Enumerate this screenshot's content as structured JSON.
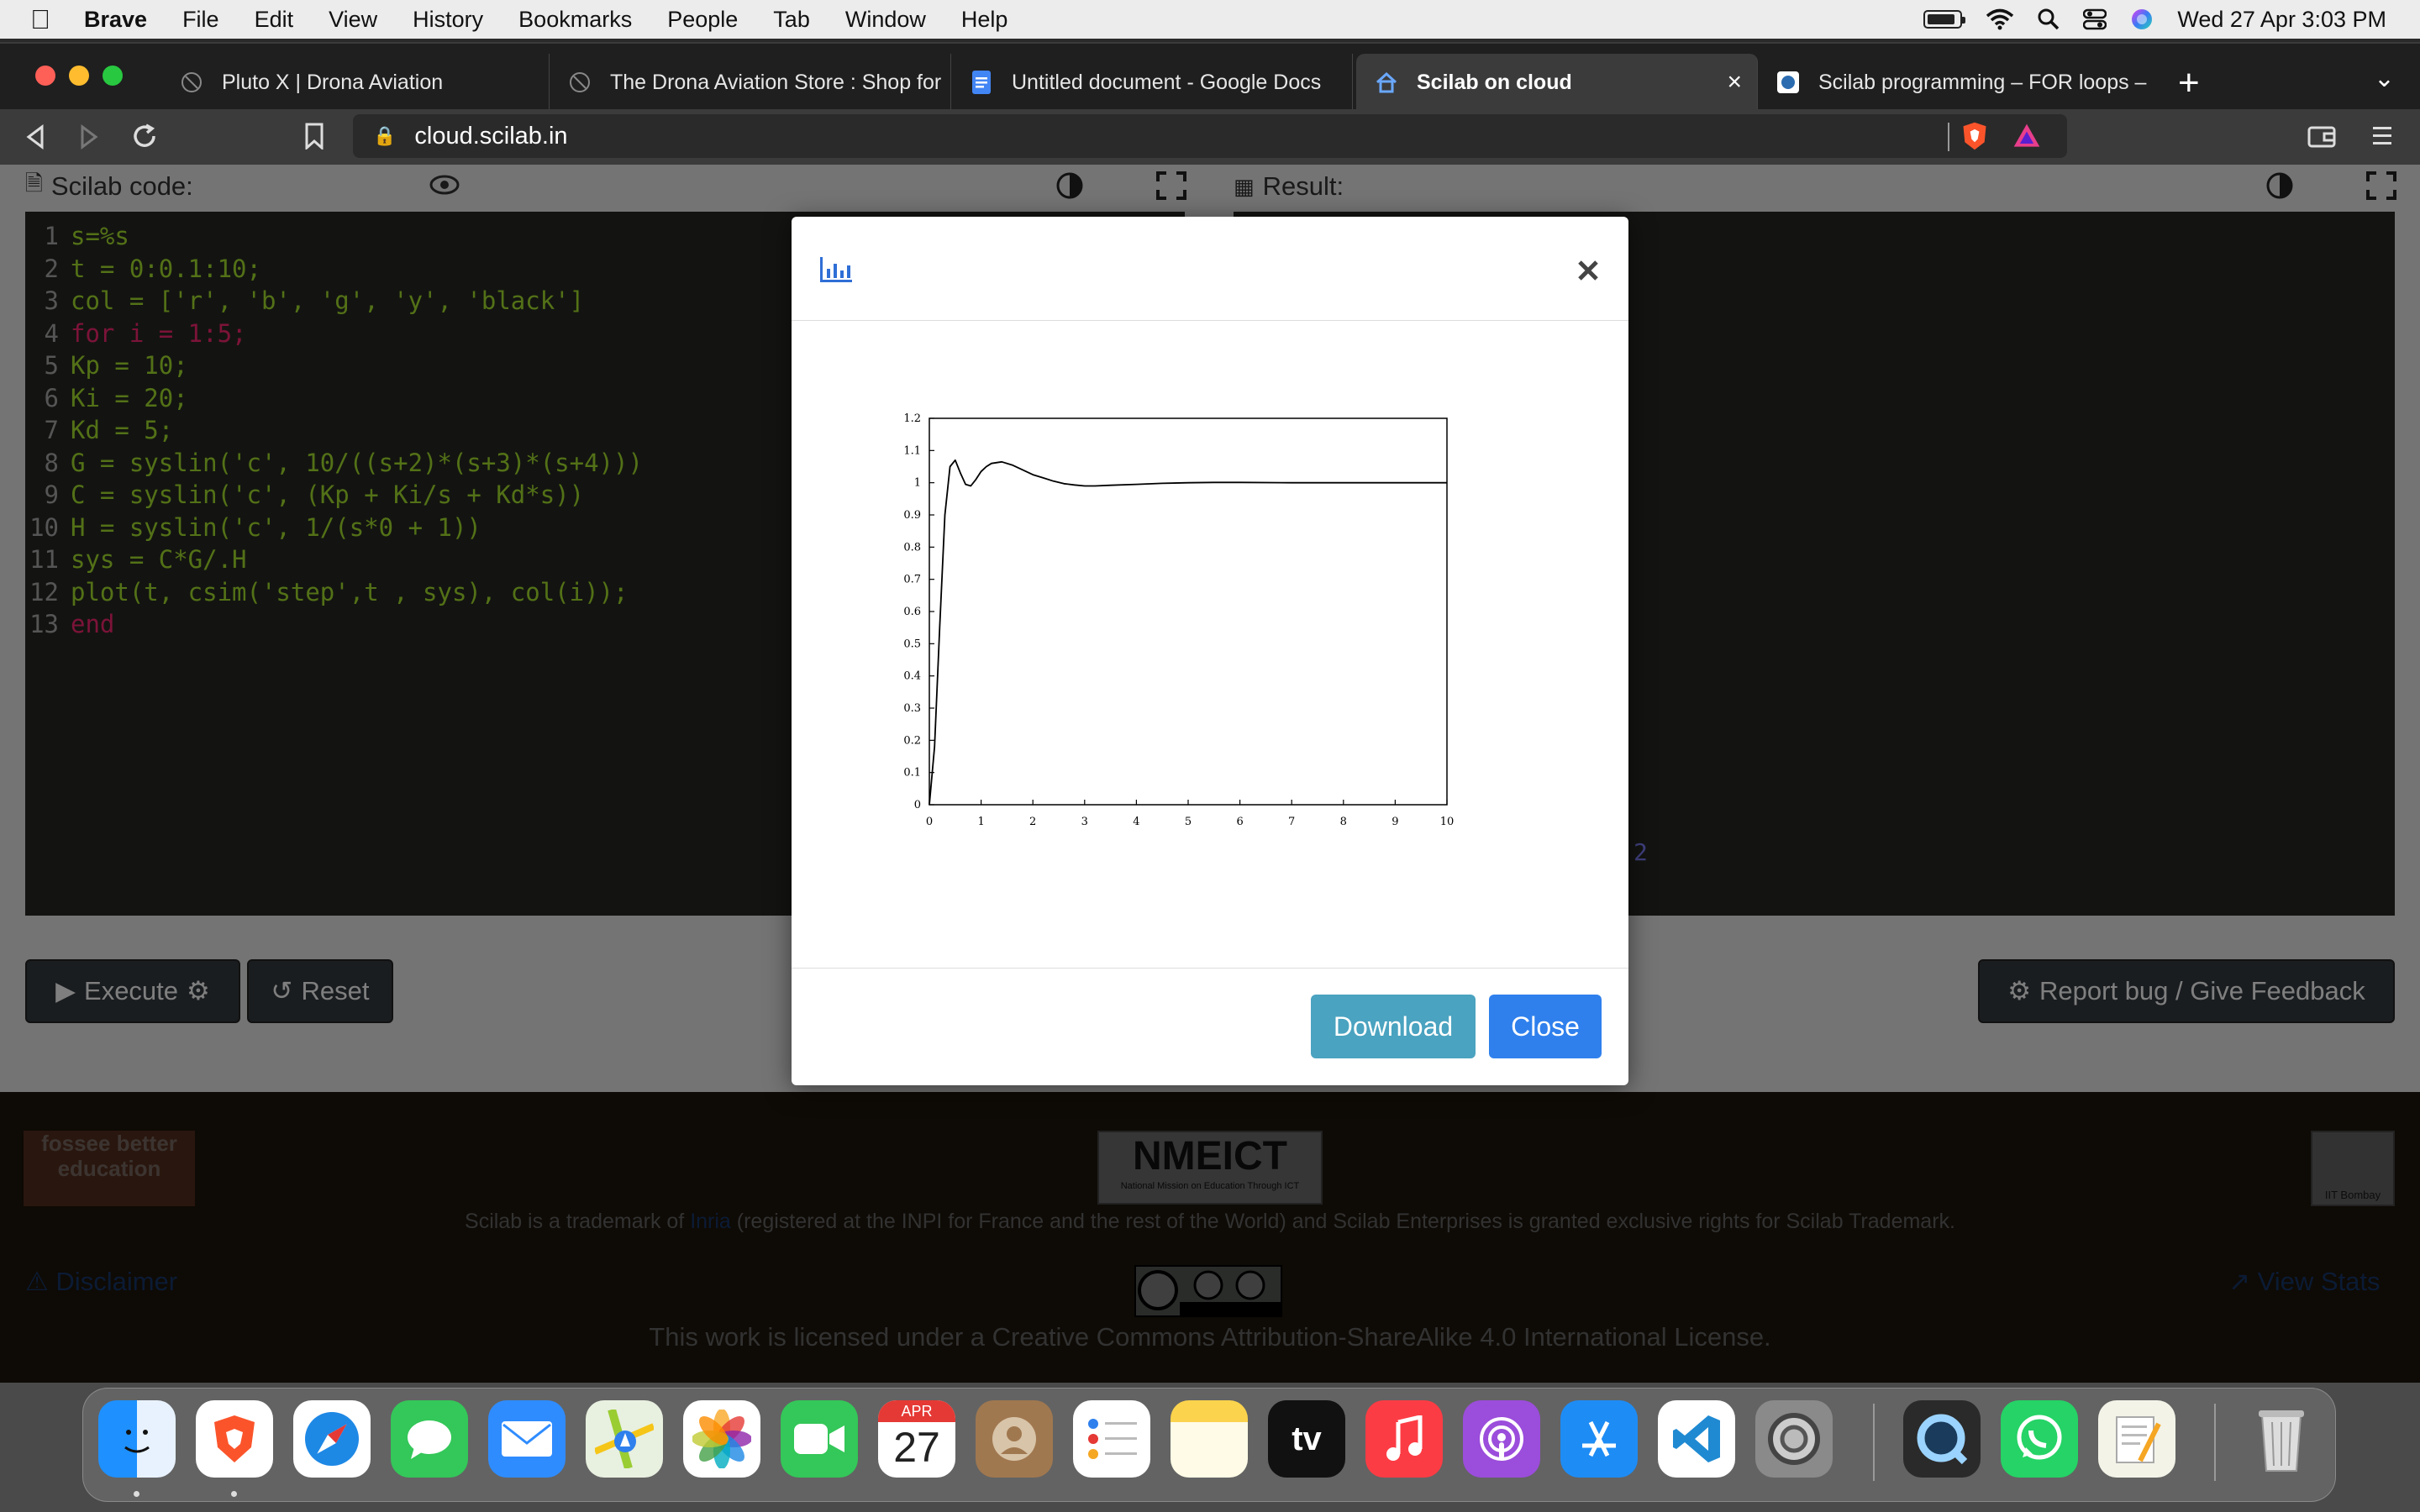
{
  "menubar": {
    "app": "Brave",
    "items": [
      "File",
      "Edit",
      "View",
      "History",
      "Bookmarks",
      "People",
      "Tab",
      "Window",
      "Help"
    ],
    "clock": "Wed 27 Apr  3:03 PM"
  },
  "tabs": [
    {
      "title": "Pluto X | Drona Aviation"
    },
    {
      "title": "The Drona Aviation Store : Shop for"
    },
    {
      "title": "Untitled document - Google Docs"
    },
    {
      "title": "Scilab on cloud"
    },
    {
      "title": "Scilab programming – FOR loops –"
    }
  ],
  "toolbar": {
    "url": "cloud.scilab.in"
  },
  "editor": {
    "header": "Scilab code:",
    "lines": [
      {
        "n": "1",
        "t": "s=%s"
      },
      {
        "n": "2",
        "t": "t = 0:0.1:10;"
      },
      {
        "n": "3",
        "t": "col = ['r', 'b', 'g', 'y', 'black']"
      },
      {
        "n": "4",
        "t": "for i = 1:5;"
      },
      {
        "n": "5",
        "t": "Kp = 10;"
      },
      {
        "n": "6",
        "t": "Ki = 20;"
      },
      {
        "n": "7",
        "t": "Kd = 5;"
      },
      {
        "n": "8",
        "t": "G = syslin('c', 10/((s+2)*(s+3)*(s+4)))"
      },
      {
        "n": "9",
        "t": "C = syslin('c', (Kp + Ki/s + Kd*s))"
      },
      {
        "n": "10",
        "t": "H = syslin('c', 1/(s*0 + 1))"
      },
      {
        "n": "11",
        "t": "sys = C*G/.H"
      },
      {
        "n": "12",
        "t": "plot(t, csim('step',t , sys), col(i));"
      },
      {
        "n": "13",
        "t": "end"
      }
    ]
  },
  "result": {
    "header": "Result:",
    "partial_text": "2"
  },
  "buttons": {
    "execute": "Execute",
    "reset": "Reset",
    "report": "Report bug / Give Feedback"
  },
  "footer": {
    "fossee_logo": "fossee better education",
    "nmeict_logo": "NMEICT",
    "nmeict_sub": "National Mission on Education Through ICT",
    "iit_logo": "IIT Bombay",
    "trademark_pre": "Scilab is a trademark of ",
    "trademark_link": "Inria",
    "trademark_post": " (registered at the INPI for France and the rest of the World) and Scilab Enterprises is granted exclusive rights for Scilab Trademark.",
    "disclaimer": "Disclaimer",
    "view_stats": "View Stats",
    "license": "This work is licensed under a Creative Commons Attribution-ShareAlike 4.0 International License."
  },
  "modal": {
    "download": "Download",
    "close": "Close"
  },
  "chart_data": {
    "type": "line",
    "xlim": [
      0,
      10
    ],
    "ylim": [
      0,
      1.2
    ],
    "x_ticks": [
      "0",
      "1",
      "2",
      "3",
      "4",
      "5",
      "6",
      "7",
      "8",
      "9",
      "10"
    ],
    "y_ticks": [
      "0",
      "0.1",
      "0.2",
      "0.3",
      "0.4",
      "0.5",
      "0.6",
      "0.7",
      "0.8",
      "0.9",
      "1",
      "1.1",
      "1.2"
    ],
    "grid": false,
    "series": [
      {
        "color": "#000000",
        "x": [
          0,
          0.1,
          0.2,
          0.3,
          0.4,
          0.5,
          0.6,
          0.7,
          0.8,
          0.9,
          1.0,
          1.1,
          1.2,
          1.4,
          1.6,
          1.8,
          2.0,
          2.2,
          2.4,
          2.6,
          2.8,
          3.0,
          3.2,
          3.5,
          4.0,
          4.5,
          5.0,
          5.5,
          6.0,
          7.0,
          8.0,
          9.0,
          10.0
        ],
        "y": [
          0,
          0.18,
          0.55,
          0.9,
          1.05,
          1.07,
          1.03,
          0.995,
          0.99,
          1.01,
          1.035,
          1.05,
          1.06,
          1.065,
          1.055,
          1.04,
          1.025,
          1.015,
          1.005,
          0.997,
          0.993,
          0.99,
          0.99,
          0.992,
          0.995,
          0.998,
          1.0,
          1.001,
          1.001,
          1.0,
          1.0,
          1.0,
          1.0
        ]
      }
    ]
  },
  "dock": {
    "calendar_month": "APR",
    "calendar_day": "27",
    "tv_label": "tv"
  }
}
